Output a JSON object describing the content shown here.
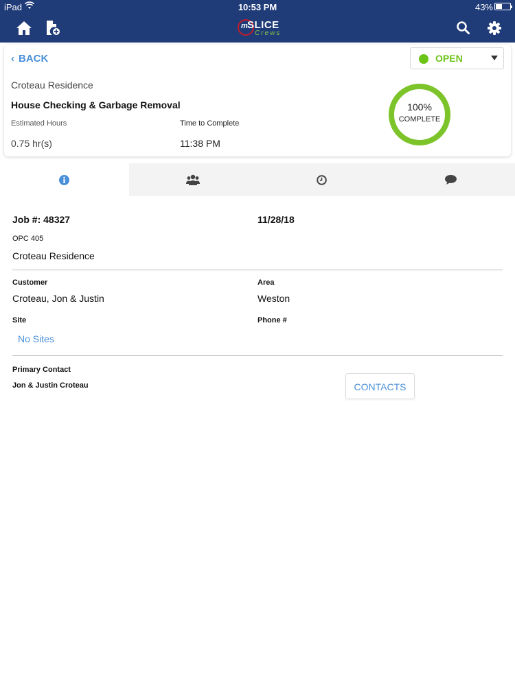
{
  "status_bar": {
    "carrier": "iPad",
    "time": "10:53 PM",
    "battery_pct": "43%",
    "battery_level": 0.43
  },
  "nav": {
    "icons": [
      "home-icon",
      "new-document-icon",
      "search-icon",
      "gear-icon"
    ],
    "logo": {
      "prefix": "m",
      "name": "SLICE",
      "sub": "Crews"
    }
  },
  "job": {
    "back_label": "BACK",
    "status": "OPEN",
    "status_color": "#6cc417",
    "site": "Croteau Residence",
    "title": "House Checking & Garbage Removal",
    "estimated_hours_label": "Estimated Hours",
    "estimated_hours": "0.75 hr(s)",
    "time_to_complete_label": "Time to Complete",
    "time_to_complete": "11:38 PM",
    "progress_pct": "100%",
    "progress_caption": "COMPLETE",
    "progress_value": 1.0,
    "progress_color": "#7cc42a"
  },
  "tabs": [
    {
      "icon": "info-icon",
      "active": true
    },
    {
      "icon": "crew-icon",
      "active": false
    },
    {
      "icon": "clock-icon",
      "active": false
    },
    {
      "icon": "chat-icon",
      "active": false
    }
  ],
  "details": {
    "job_number": "Job #: 48327",
    "date": "11/28/18",
    "code": "OPC 405",
    "site_name": "Croteau Residence",
    "customer_label": "Customer",
    "customer": "Croteau, Jon & Justin",
    "area_label": "Area",
    "area": "Weston",
    "site_label": "Site",
    "site_value": "No Sites",
    "phone_label": "Phone #",
    "primary_contact_label": "Primary Contact",
    "primary_contact": "Jon & Justin Croteau",
    "contacts_button": "CONTACTS"
  },
  "colors": {
    "header_bg": "#1f3b78",
    "link": "#4a90d9",
    "accent_green": "#7cc42a"
  }
}
